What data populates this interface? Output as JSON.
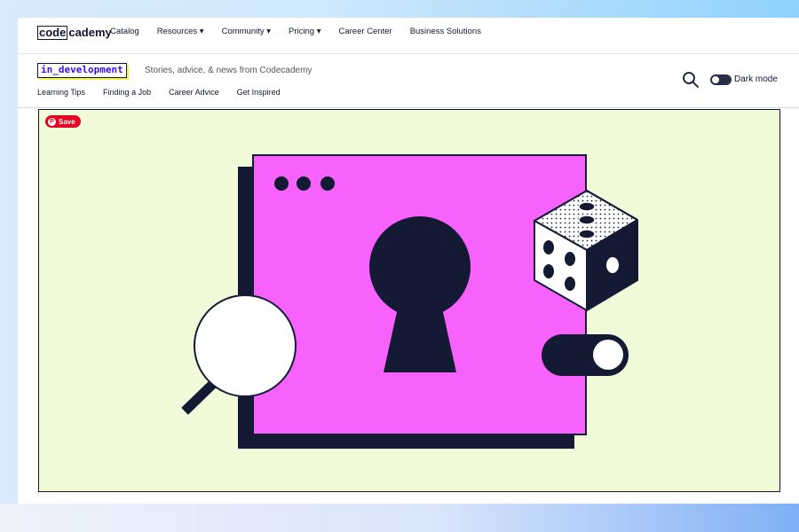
{
  "topnav": {
    "logo_boxed": "code",
    "logo_rest": "cademy",
    "items": [
      "Catalog",
      "Resources ▾",
      "Community ▾",
      "Pricing ▾",
      "Career Center",
      "Business Solutions"
    ]
  },
  "blog": {
    "badge": "in_development",
    "tagline": "Stories, advice, & news from Codecademy",
    "subnav": [
      "Learning Tips",
      "Finding a Job",
      "Career Advice",
      "Get Inspired"
    ],
    "dark_mode_label": "Dark mode"
  },
  "hero": {
    "save_label": "Save",
    "colors": {
      "background": "#f1fbd9",
      "window": "#f662fb",
      "ink": "#141a33",
      "white": "#ffffff"
    }
  }
}
